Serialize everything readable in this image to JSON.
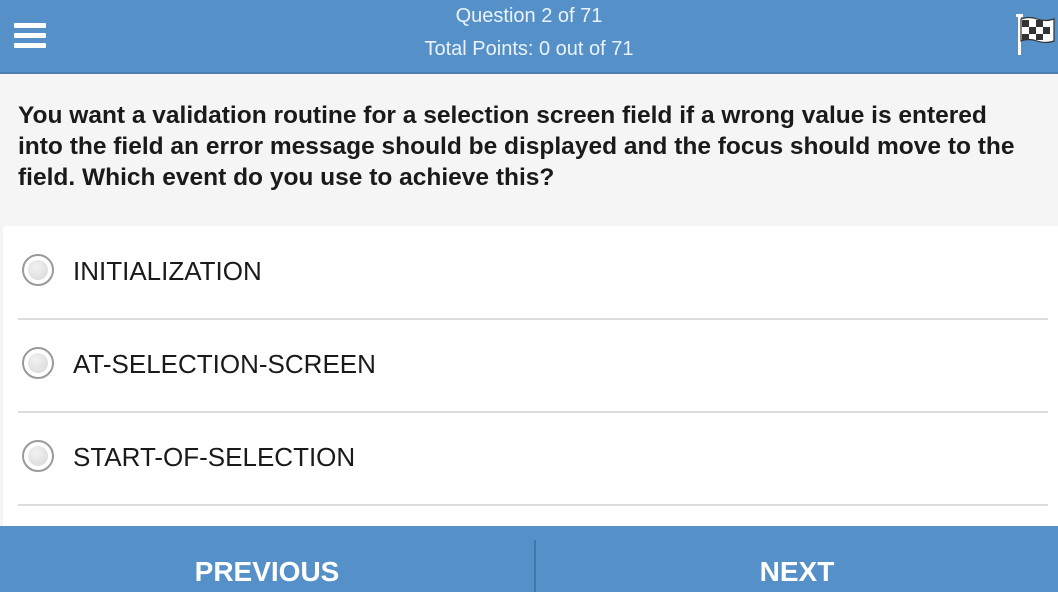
{
  "header": {
    "question_counter": "Question 2 of 71",
    "total_points": "Total Points: 0 out of 71",
    "menu_icon": "hamburger-menu-icon",
    "flag_icon": "checkered-flag-icon",
    "bg_color": "#5591c8"
  },
  "question": {
    "text": "You want a validation routine for a selection screen field if a wrong value is entered into the field an error message should be displayed and the focus should move to the field. Which event do you use to achieve this?"
  },
  "options": [
    {
      "label": "INITIALIZATION",
      "selected": false
    },
    {
      "label": "AT-SELECTION-SCREEN",
      "selected": false
    },
    {
      "label": "START-OF-SELECTION",
      "selected": false
    }
  ],
  "footer": {
    "previous_label": "PREVIOUS",
    "next_label": "NEXT"
  }
}
